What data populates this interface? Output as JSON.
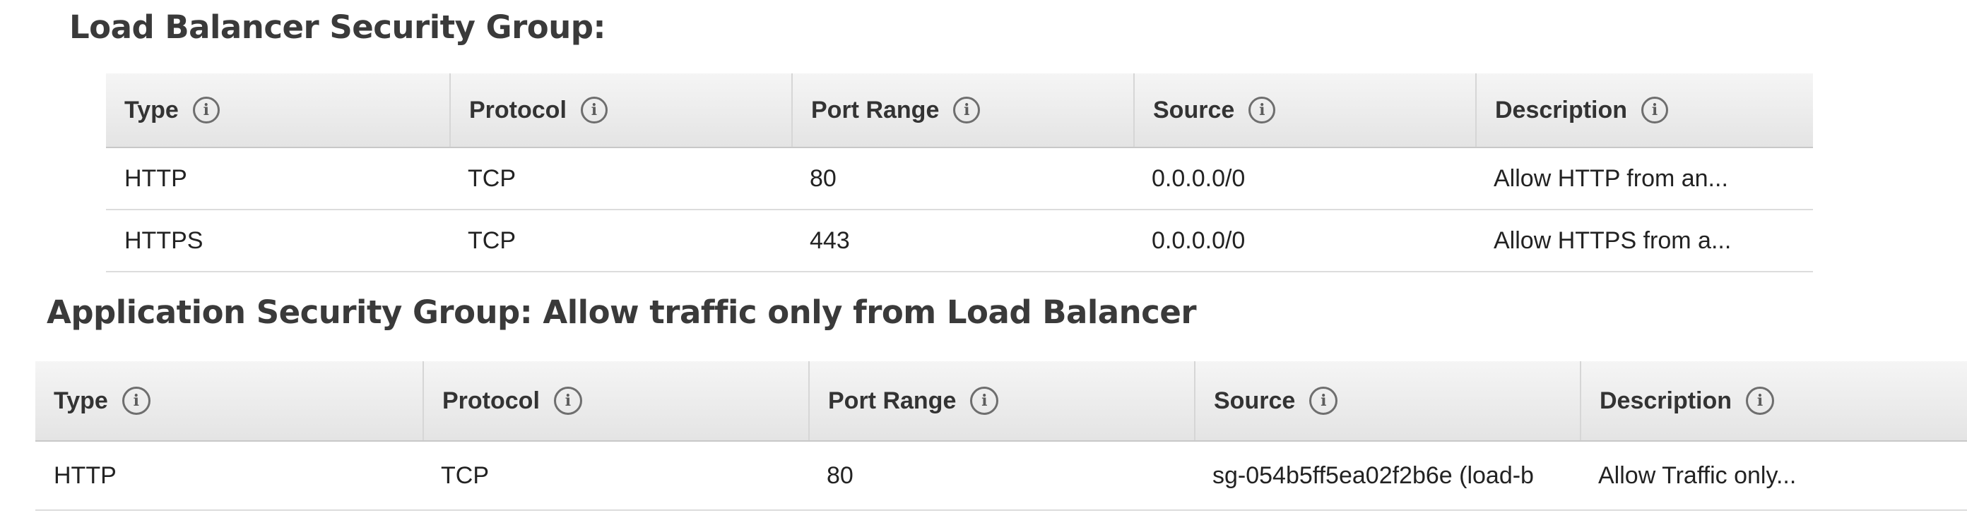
{
  "sections": [
    {
      "title": "Load Balancer Security Group:",
      "columns": [
        "Type",
        "Protocol",
        "Port Range",
        "Source",
        "Description"
      ],
      "rows": [
        [
          "HTTP",
          "TCP",
          "80",
          "0.0.0.0/0",
          "Allow HTTP from an..."
        ],
        [
          "HTTPS",
          "TCP",
          "443",
          "0.0.0.0/0",
          "Allow HTTPS from a..."
        ]
      ]
    },
    {
      "title": "Application Security Group: Allow traffic only from Load Balancer",
      "columns": [
        "Type",
        "Protocol",
        "Port Range",
        "Source",
        "Description"
      ],
      "rows": [
        [
          "HTTP",
          "TCP",
          "80",
          "sg-054b5ff5ea02f2b6e (load-b",
          "Allow Traffic only..."
        ]
      ]
    }
  ],
  "icons": {
    "column_info": "info-circle-icon"
  }
}
